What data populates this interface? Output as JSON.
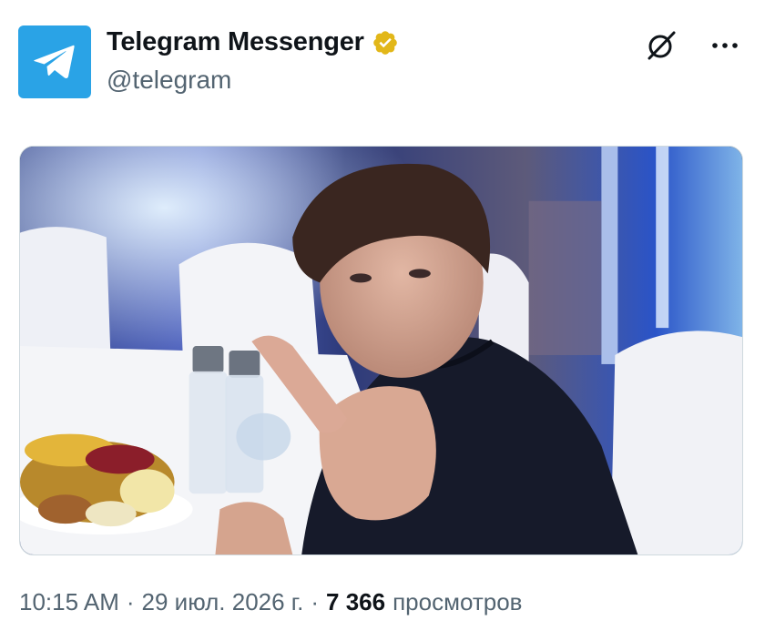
{
  "author": {
    "name": "Telegram Messenger",
    "handle": "@telegram",
    "avatar_icon": "telegram-paper-plane-icon",
    "avatar_color": "#2aa3e6",
    "verified_icon": "gold-verified-badge-icon",
    "verified_color": "#e2b719"
  },
  "actions": {
    "grok_icon": "grok-icon",
    "more_icon": "more-horizontal-icon"
  },
  "media": {
    "type": "photo"
  },
  "meta": {
    "time": "10:15 AM",
    "separator": "·",
    "date": "29 июл. 2026 г.",
    "views_count": "7 366",
    "views_label": "просмотров"
  },
  "colors": {
    "text_primary": "#0f1419",
    "text_secondary": "#536471",
    "border": "#cfd9de"
  }
}
